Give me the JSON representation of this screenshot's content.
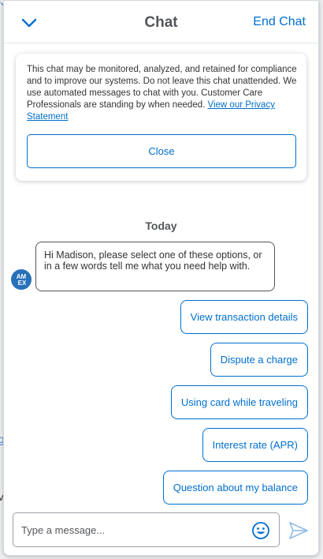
{
  "header": {
    "title": "Chat",
    "end_chat_label": "End Chat"
  },
  "privacy_notice": {
    "text": "This chat may be monitored, analyzed, and retained for compliance and to improve our systems. Do not leave this chat unattended. We use automated messages to chat with you. Customer Care Professionals are standing by when needed. ",
    "link_label": "View our Privacy Statement",
    "close_label": "Close"
  },
  "conversation": {
    "day_label": "Today",
    "agent_avatar_text": "AM EX",
    "agent_message": "Hi Madison, please select one of these options, or in a few words tell me what you need help with."
  },
  "quick_replies": [
    "View transaction details",
    "Dispute a charge",
    "Using card while traveling",
    "Interest rate (APR)",
    "Question about my balance"
  ],
  "composer": {
    "placeholder": "Type a message..."
  },
  "colors": {
    "accent": "#006fcf",
    "title_gray": "#53565a",
    "avatar_blue": "#2671b9"
  },
  "icons": {
    "collapse": "chevron-down-icon",
    "emoji": "smiley-icon",
    "send": "send-arrow-icon"
  }
}
